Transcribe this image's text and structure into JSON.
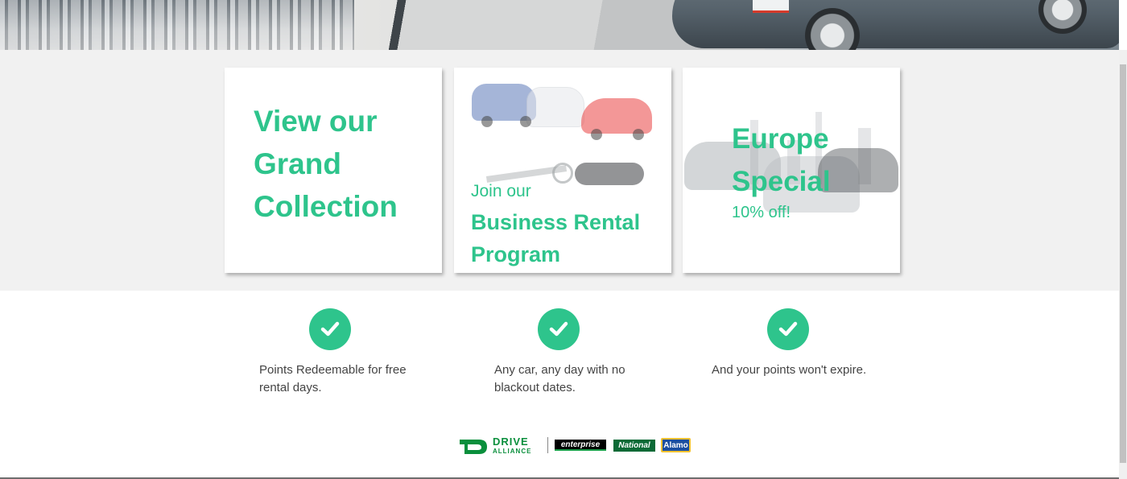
{
  "hero": {
    "image": "city-road-car-banner"
  },
  "cards": [
    {
      "title": "View our Grand Collection"
    },
    {
      "subtitle": "Join our",
      "title": "Business Rental Program"
    },
    {
      "title": "Europe Special",
      "subtitle": "10% off!"
    }
  ],
  "features": [
    {
      "icon": "check-circle-icon",
      "text": "Points Redeemable for free rental days."
    },
    {
      "icon": "check-circle-icon",
      "text": "Any car, any day with no blackout dates."
    },
    {
      "icon": "check-circle-icon",
      "text": "And your points won't expire."
    }
  ],
  "logos": {
    "drive_alliance": {
      "line1": "DRIVE",
      "line2": "ALLIANCE"
    },
    "enterprise": "enterprise",
    "national": "National",
    "alamo": "Alamo"
  },
  "colors": {
    "accent": "#2ec48c",
    "band": "#f1f1f1",
    "text": "#444444"
  }
}
